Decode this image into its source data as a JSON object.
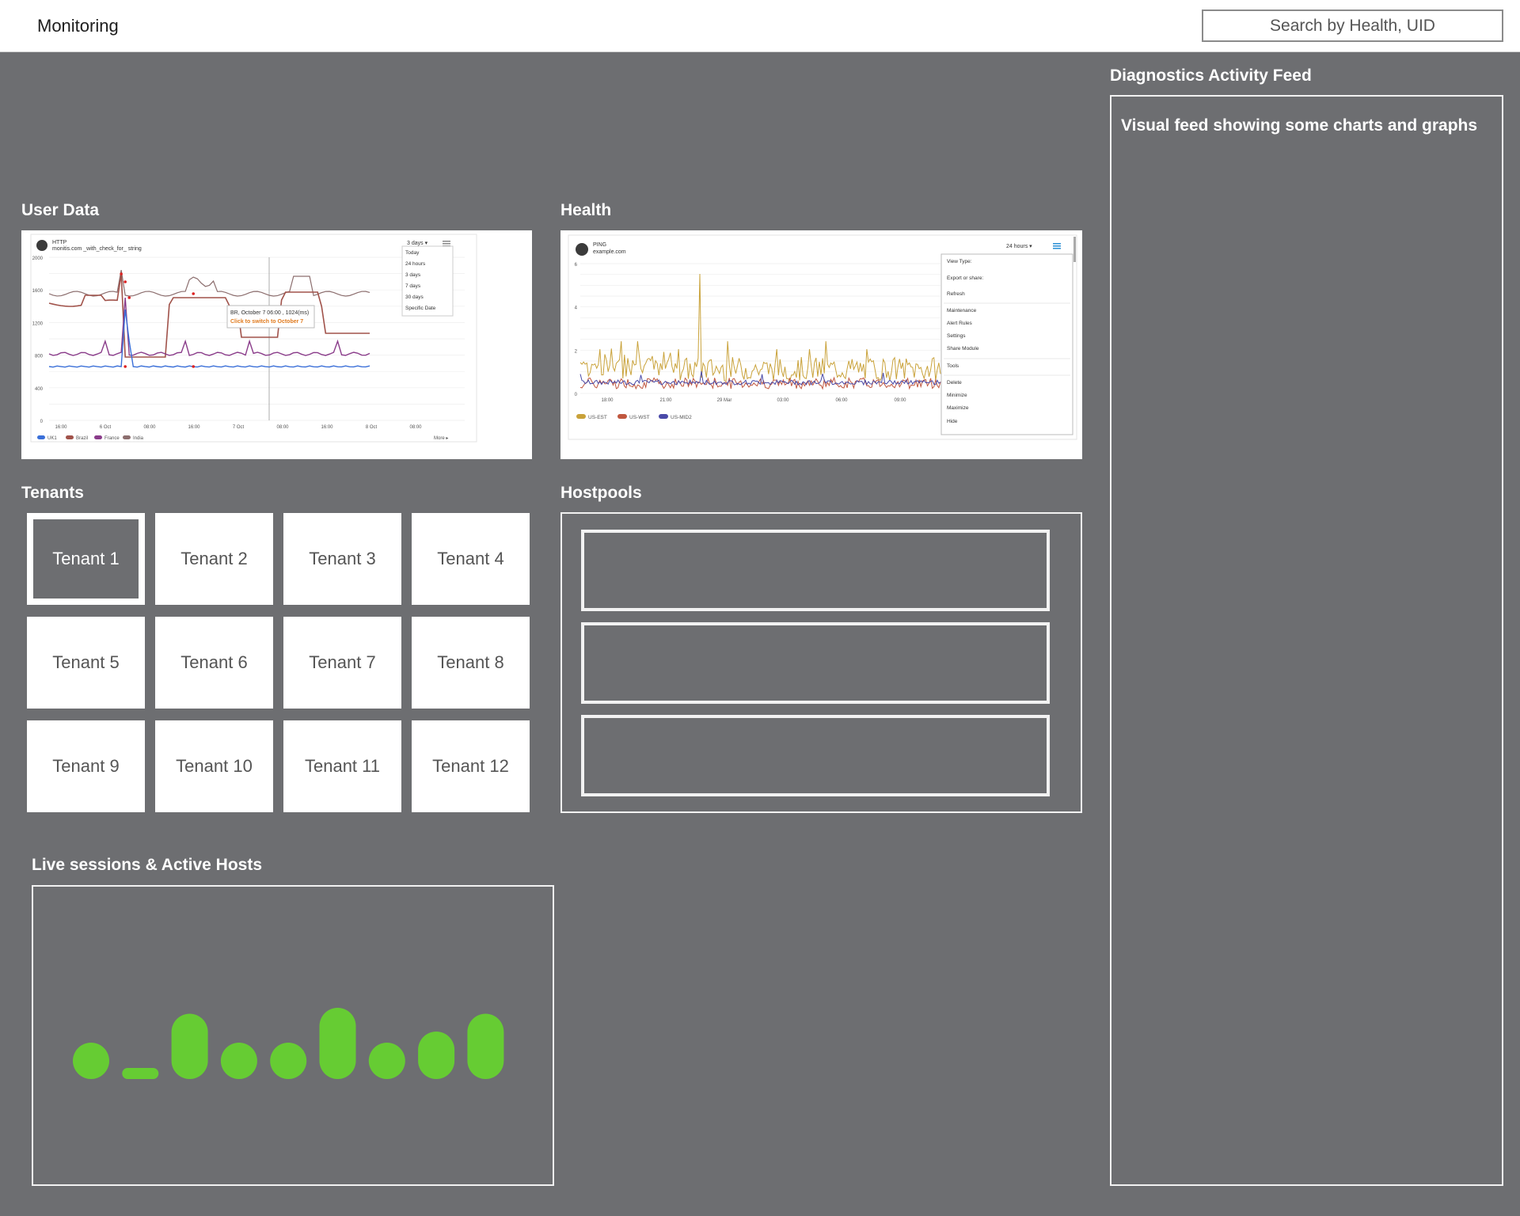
{
  "header": {
    "title": "Monitoring",
    "search_placeholder": "Search by Health, UID"
  },
  "sections": {
    "user_data": "User Data",
    "health": "Health",
    "tenants": "Tenants",
    "hostpools": "Hostpools",
    "live": "Live sessions & Active Hosts",
    "feed": "Diagnostics Activity Feed"
  },
  "feed": {
    "text": "Visual feed showing some charts and graphs"
  },
  "tenants": [
    {
      "label": "Tenant 1",
      "selected": true
    },
    {
      "label": "Tenant 2"
    },
    {
      "label": "Tenant 3"
    },
    {
      "label": "Tenant 4"
    },
    {
      "label": "Tenant 5"
    },
    {
      "label": "Tenant 6"
    },
    {
      "label": "Tenant 7"
    },
    {
      "label": "Tenant 8"
    },
    {
      "label": "Tenant 9"
    },
    {
      "label": "Tenant 10"
    },
    {
      "label": "Tenant 11"
    },
    {
      "label": "Tenant 12"
    }
  ],
  "hostpools": [
    {},
    {},
    {}
  ],
  "user_chart": {
    "title": "HTTP",
    "subtitle": "monitis.com _with_check_for_ string",
    "range": "3 days ▾",
    "menu": [
      "Today",
      "24 hours",
      "3 days",
      "7 days",
      "30 days",
      "Specific Date"
    ],
    "y_ticks": [
      "2000",
      "1600",
      "1200",
      "800",
      "400",
      "0"
    ],
    "x_ticks": [
      "16:00",
      "6 Oct",
      "08:00",
      "16:00",
      "7 Oct",
      "08:00",
      "16:00",
      "8 Oct",
      "08:00"
    ],
    "tooltip_line1": "BR, October 7 06:00 , 1024(ms)",
    "tooltip_line2": "Click to switch to October 7",
    "legend": [
      "UK1",
      "Brazil",
      "France",
      "India"
    ],
    "more": "More ▸",
    "colors": {
      "blue": "#3a6fd8",
      "brown": "#a0524a",
      "purple": "#8a3c8a",
      "gray": "#8c6e6e",
      "orange": "#e07b1f"
    }
  },
  "health_chart": {
    "title": "PING",
    "subtitle": "example.com",
    "range": "24 hours ▾",
    "y_ticks": [
      "6",
      "4",
      "2",
      "0"
    ],
    "x_ticks": [
      "18:00",
      "21:00",
      "29 Mar",
      "03:00",
      "06:00",
      "09:00"
    ],
    "legend": [
      "US-EST",
      "US-WST",
      "US-MID2"
    ],
    "menu": [
      "View Type:",
      "Export or share:",
      "Refresh",
      "Maintenance",
      "Alert Rules",
      "Settings",
      "Share Module",
      "Tools",
      "Delete",
      "Minimize",
      "Maximize",
      "Hide"
    ],
    "colors": {
      "gold": "#c9a23a",
      "red": "#c0573f",
      "blue": "#4a4aa8"
    }
  },
  "live_bars": [
    {
      "level": 0.2
    },
    {
      "level": 0.07
    },
    {
      "level": 0.55
    },
    {
      "level": 0.2
    },
    {
      "level": 0.14
    },
    {
      "level": 0.6
    },
    {
      "level": 0.14
    },
    {
      "level": 0.4
    },
    {
      "level": 0.55
    }
  ],
  "accent": "#66cc33"
}
